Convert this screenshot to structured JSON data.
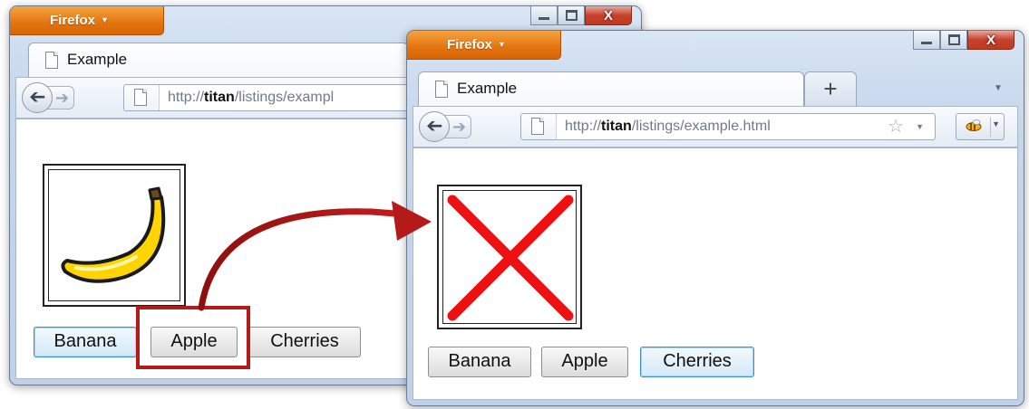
{
  "browser_menu_label": "Firefox",
  "close_glyph": "X",
  "left_window": {
    "tab_label": "Example",
    "url_prefix": "http://",
    "url_host": "titan",
    "url_path": "/listings/exampl",
    "displayed_image": "banana",
    "buttons": [
      "Banana",
      "Apple",
      "Cherries"
    ],
    "focused_button": "Banana",
    "highlighted_button": "Apple"
  },
  "right_window": {
    "tab_label": "Example",
    "new_tab_glyph": "+",
    "url_prefix": "http://",
    "url_host": "titan",
    "url_path": "/listings/example.html",
    "displayed_image": "broken-image-x",
    "buttons": [
      "Banana",
      "Apple",
      "Cherries"
    ],
    "focused_button": "Cherries"
  },
  "icons": {
    "back": "back-arrow-icon",
    "forward": "forward-arrow-icon",
    "page": "page-icon",
    "bookmark": "star-icon",
    "addon": "bee-icon"
  },
  "colors": {
    "firefox_orange": "#e3730f",
    "close_red": "#c7412c",
    "annotation_red": "#b31b1b",
    "broken_x_red": "#ee1111",
    "banana_yellow": "#ffd400",
    "focus_blue": "#3c8fd0"
  }
}
